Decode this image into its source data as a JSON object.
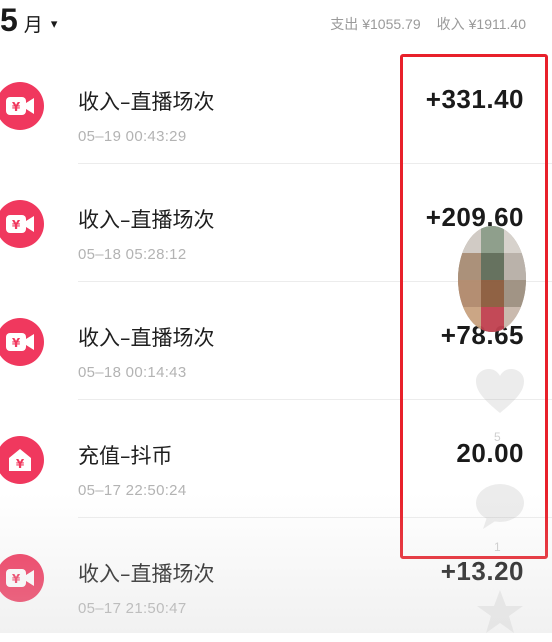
{
  "header": {
    "month_number": "5",
    "month_unit": "月",
    "caret": "▾",
    "expense_label": "支出",
    "expense_value": "¥1055.79",
    "income_label": "收入",
    "income_value": "¥1911.40"
  },
  "transactions": [
    {
      "title": "收入–直播场次",
      "time": "05–19 00:43:29",
      "amount": "+331.40",
      "icon": "video-yuan-icon"
    },
    {
      "title": "收入–直播场次",
      "time": "05–18 05:28:12",
      "amount": "+209.60",
      "icon": "video-yuan-icon"
    },
    {
      "title": "收入–直播场次",
      "time": "05–18 00:14:43",
      "amount": "+78.65",
      "icon": "video-yuan-icon"
    },
    {
      "title": "充值–抖币",
      "time": "05–17 22:50:24",
      "amount": "20.00",
      "icon": "house-yuan-icon"
    },
    {
      "title": "收入–直播场次",
      "time": "05–17 21:50:47",
      "amount": "+13.20",
      "icon": "video-yuan-icon"
    }
  ],
  "overlay": {
    "like_count": "5",
    "comment_count": "1"
  },
  "colors": {
    "accent": "#f0385e",
    "highlight_box": "#e8202a"
  }
}
